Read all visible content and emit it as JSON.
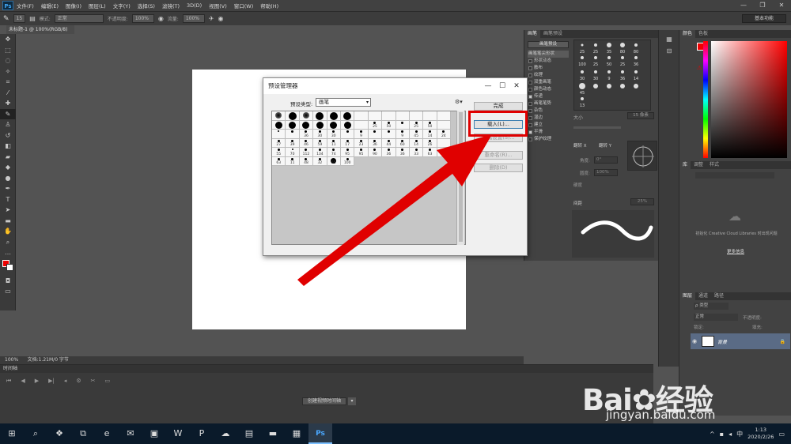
{
  "app": {
    "logo": "Ps",
    "menu": [
      "文件(F)",
      "编辑(E)",
      "图像(I)",
      "图层(L)",
      "文字(Y)",
      "选择(S)",
      "滤镜(T)",
      "3D(D)",
      "视图(V)",
      "窗口(W)",
      "帮助(H)"
    ],
    "window_controls": [
      "—",
      "❐",
      "✕"
    ]
  },
  "options": {
    "brush_size": "15",
    "mode_label": "模式:",
    "mode_value": "正常",
    "opacity_label": "不透明度:",
    "opacity_value": "100%",
    "flow_label": "流量:",
    "flow_value": "100%",
    "workspace": "基本功能"
  },
  "document": {
    "tab": "未标题-1 @ 100%(RGB/8)",
    "zoom": "100%",
    "docinfo": "文档:1.21M/0 字节"
  },
  "timeline": {
    "title": "时间轴",
    "create_button": "创建视频时间轴"
  },
  "brush_panel": {
    "tabs": [
      "画笔",
      "画笔预设"
    ],
    "preset_button": "画笔预设",
    "tip_shape_button": "画笔笔尖形状",
    "items": [
      "形状动态",
      "散布",
      "纹理",
      "双重画笔",
      "颜色动态",
      "传递",
      "画笔笔势",
      "杂色",
      "湿边",
      "建立",
      "平滑",
      "保护纹理"
    ],
    "checked": [
      false,
      false,
      false,
      false,
      false,
      true,
      false,
      false,
      false,
      false,
      true,
      false
    ],
    "size_label": "大小",
    "size_value": "15 像素",
    "flip_x": "翻转 X",
    "flip_y": "翻转 Y",
    "angle_label": "角度:",
    "angle_value": "0°",
    "roundness_label": "圆度:",
    "roundness_value": "100%",
    "hardness_label": "硬度",
    "spacing_label": "间距",
    "spacing_value": "25%",
    "tip_numbers": [
      "25",
      "25",
      "35",
      "80",
      "80",
      "100",
      "25",
      "50",
      "25",
      "36",
      "30",
      "30",
      "9",
      "36",
      "14",
      "45",
      "13"
    ]
  },
  "color_panel": {
    "tabs": [
      "颜色",
      "色板"
    ],
    "fg_color": "#e00000"
  },
  "libraries_panel": {
    "tabs": [
      "库",
      "调整",
      "样式"
    ],
    "message": "初始化 Creative Cloud Libraries 时出现问题",
    "more_link": "更多信息"
  },
  "layers_panel": {
    "tabs": [
      "图层",
      "通道",
      "路径"
    ],
    "filter": "ρ 类型",
    "blend": "正常",
    "opacity_label": "不透明度:",
    "lock_label": "锁定:",
    "fill_label": "填充:",
    "layer_name": "背景"
  },
  "dialog": {
    "title": "预设管理器",
    "preset_type_label": "预设类型:",
    "preset_type_value": "画笔",
    "buttons": {
      "done": "完成",
      "load": "载入(L)...",
      "save": "存储设置(S)...",
      "rename": "重命名(R)...",
      "delete": "删除(D)"
    },
    "cells": [
      {
        "d": 8,
        "n": ""
      },
      {
        "d": 12,
        "n": ""
      },
      {
        "d": 8,
        "n": ""
      },
      {
        "d": 12,
        "n": ""
      },
      {
        "d": 12,
        "n": ""
      },
      {
        "d": 12,
        "n": ""
      },
      {
        "d": 0,
        "n": ""
      },
      {
        "d": 0,
        "n": ""
      },
      {
        "d": 0,
        "n": ""
      },
      {
        "d": 0,
        "n": ""
      },
      {
        "d": 0,
        "n": ""
      },
      {
        "d": 0,
        "n": ""
      },
      {
        "d": 0,
        "n": ""
      },
      {
        "d": 9,
        "n": ""
      },
      {
        "d": 9,
        "n": ""
      },
      {
        "d": 9,
        "n": ""
      },
      {
        "d": 9,
        "n": ""
      },
      {
        "d": 9,
        "n": ""
      },
      {
        "d": 9,
        "n": ""
      },
      {
        "d": 0,
        "n": ""
      },
      {
        "d": 3,
        "n": "25"
      },
      {
        "d": 3,
        "n": "50"
      },
      {
        "d": 3,
        "n": ""
      },
      {
        "d": 3,
        "n": "25"
      },
      {
        "d": 3,
        "n": "50"
      },
      {
        "d": 0,
        "n": ""
      },
      {
        "d": 2,
        "n": ""
      },
      {
        "d": 3,
        "n": ""
      },
      {
        "d": 3,
        "n": "36"
      },
      {
        "d": 3,
        "n": "30"
      },
      {
        "d": 3,
        "n": "30"
      },
      {
        "d": 3,
        "n": ""
      },
      {
        "d": 3,
        "n": "9"
      },
      {
        "d": 3,
        "n": ""
      },
      {
        "d": 3,
        "n": ""
      },
      {
        "d": 3,
        "n": "9"
      },
      {
        "d": 3,
        "n": "45"
      },
      {
        "d": 3,
        "n": "14"
      },
      {
        "d": 3,
        "n": "24"
      },
      {
        "d": 3,
        "n": "27"
      },
      {
        "d": 3,
        "n": "39"
      },
      {
        "d": 3,
        "n": "46"
      },
      {
        "d": 3,
        "n": "59"
      },
      {
        "d": 3,
        "n": "11"
      },
      {
        "d": 3,
        "n": "17"
      },
      {
        "d": 3,
        "n": "23"
      },
      {
        "d": 3,
        "n": "36"
      },
      {
        "d": 3,
        "n": "44"
      },
      {
        "d": 3,
        "n": "60"
      },
      {
        "d": 3,
        "n": "14"
      },
      {
        "d": 3,
        "n": "26"
      },
      {
        "d": 0,
        "n": ""
      },
      {
        "d": 3,
        "n": "55"
      },
      {
        "d": 2,
        "n": "70"
      },
      {
        "d": 3,
        "n": "112"
      },
      {
        "d": 3,
        "n": "134"
      },
      {
        "d": 3,
        "n": "74"
      },
      {
        "d": 3,
        "n": "95"
      },
      {
        "d": 3,
        "n": "95"
      },
      {
        "d": 3,
        "n": "90"
      },
      {
        "d": 3,
        "n": "36"
      },
      {
        "d": 3,
        "n": "36"
      },
      {
        "d": 3,
        "n": "33"
      },
      {
        "d": 3,
        "n": "63"
      },
      {
        "d": 0,
        "n": ""
      },
      {
        "d": 3,
        "n": "63"
      },
      {
        "d": 3,
        "n": "11"
      },
      {
        "d": 3,
        "n": "48"
      },
      {
        "d": 3,
        "n": "32"
      },
      {
        "d": 7,
        "n": "55"
      },
      {
        "d": 3,
        "n": "100"
      }
    ]
  },
  "watermark": {
    "text": "Bai✿经验",
    "url": "jingyan.baidu.com"
  },
  "taskbar": {
    "icons": [
      "⊞",
      "⌕",
      "❖",
      "⧉",
      "e",
      "✉",
      "▣",
      "W",
      "P",
      "☁",
      "▤",
      "▬",
      "▦",
      "Ps"
    ],
    "tray_lang": "中",
    "time": "1:13",
    "date": "2020/2/26"
  }
}
